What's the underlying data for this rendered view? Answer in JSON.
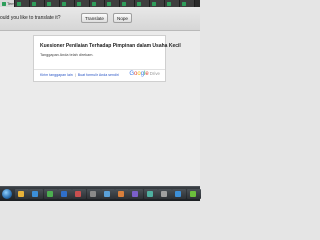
{
  "browser": {
    "tabs": [
      {
        "label": "Tem",
        "active": true
      },
      {
        "label": "",
        "active": false
      },
      {
        "label": "",
        "active": false
      },
      {
        "label": "",
        "active": false
      },
      {
        "label": "",
        "active": false
      },
      {
        "label": "",
        "active": false
      },
      {
        "label": "",
        "active": false
      },
      {
        "label": "",
        "active": false
      },
      {
        "label": "",
        "active": false
      },
      {
        "label": "",
        "active": false
      },
      {
        "label": "",
        "active": false
      },
      {
        "label": "",
        "active": false
      },
      {
        "label": "",
        "active": false
      }
    ]
  },
  "translate_bar": {
    "question": "ould you like to translate it?",
    "translate_label": "Translate",
    "nope_label": "Nope"
  },
  "form_card": {
    "title": "Kuesioner Penilaian Terhadap Pimpinan dalam Usaha Kecil",
    "message": "Tanggapan Anda telah direkam.",
    "link_submit_another": "Kirim tanggapan lain",
    "separator": "|",
    "link_create_form": "Buat formulir Anda sendiri",
    "brand_google": "Google",
    "brand_drive": "Drive"
  },
  "taskbar": {
    "items": [
      {
        "icon": "explorer-icon",
        "color": "#e8b23a"
      },
      {
        "icon": "media-player-icon",
        "color": "#3c8fd8"
      },
      {
        "icon": "browser-icon",
        "color": "#4caf50"
      },
      {
        "icon": "document-icon",
        "color": "#2f6fc9"
      },
      {
        "icon": "app-icon",
        "color": "#c94f4f"
      },
      {
        "icon": "app-icon",
        "color": "#8a8a8a"
      },
      {
        "icon": "app-icon",
        "color": "#5aa0d8"
      },
      {
        "icon": "app-icon",
        "color": "#d87f3c"
      },
      {
        "icon": "app-icon",
        "color": "#7b5fc9"
      },
      {
        "icon": "app-icon",
        "color": "#4fb0a0"
      },
      {
        "icon": "app-icon",
        "color": "#a0a0a0"
      },
      {
        "icon": "app-icon",
        "color": "#3c8fd8"
      },
      {
        "icon": "app-icon",
        "color": "#6cbf3c"
      }
    ]
  }
}
